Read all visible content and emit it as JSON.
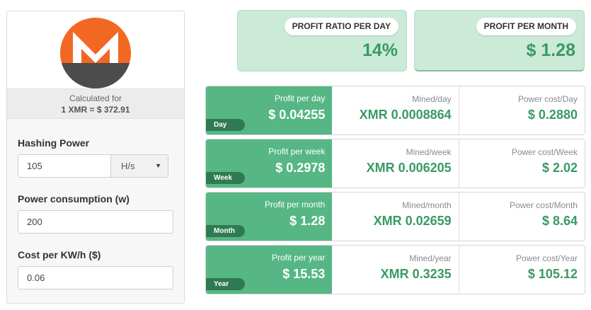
{
  "logo": {
    "icon": "monero-logo",
    "brand_color": "#f26822",
    "dark_color": "#4c4c4c"
  },
  "calc": {
    "label": "Calculated for",
    "rate": "1 XMR = $ 372.91"
  },
  "form": {
    "hashing_label": "Hashing Power",
    "hashing_value": "105",
    "hashing_unit": "H/s",
    "power_label": "Power consumption (w)",
    "power_value": "200",
    "cost_label": "Cost per KW/h ($)",
    "cost_value": "0.06"
  },
  "summary": {
    "ratio_label": "PROFIT RATIO PER DAY",
    "ratio_value": "14%",
    "month_label": "PROFIT PER MONTH",
    "month_value": "$ 1.28"
  },
  "periods": [
    {
      "tag": "Day",
      "profit_label": "Profit per day",
      "profit": "$ 0.04255",
      "mined_label": "Mined/day",
      "mined": "XMR 0.0008864",
      "cost_label": "Power cost/Day",
      "cost": "$ 0.2880"
    },
    {
      "tag": "Week",
      "profit_label": "Profit per week",
      "profit": "$ 0.2978",
      "mined_label": "Mined/week",
      "mined": "XMR 0.006205",
      "cost_label": "Power cost/Week",
      "cost": "$ 2.02"
    },
    {
      "tag": "Month",
      "profit_label": "Profit per month",
      "profit": "$ 1.28",
      "mined_label": "Mined/month",
      "mined": "XMR 0.02659",
      "cost_label": "Power cost/Month",
      "cost": "$ 8.64"
    },
    {
      "tag": "Year",
      "profit_label": "Profit per year",
      "profit": "$ 15.53",
      "mined_label": "Mined/year",
      "mined": "XMR 0.3235",
      "cost_label": "Power cost/Year",
      "cost": "$ 105.12"
    }
  ],
  "colors": {
    "accent_green": "#56b784",
    "value_green": "#3a9a63",
    "tag_green": "#2f7a52",
    "card_green": "#cbead8"
  }
}
